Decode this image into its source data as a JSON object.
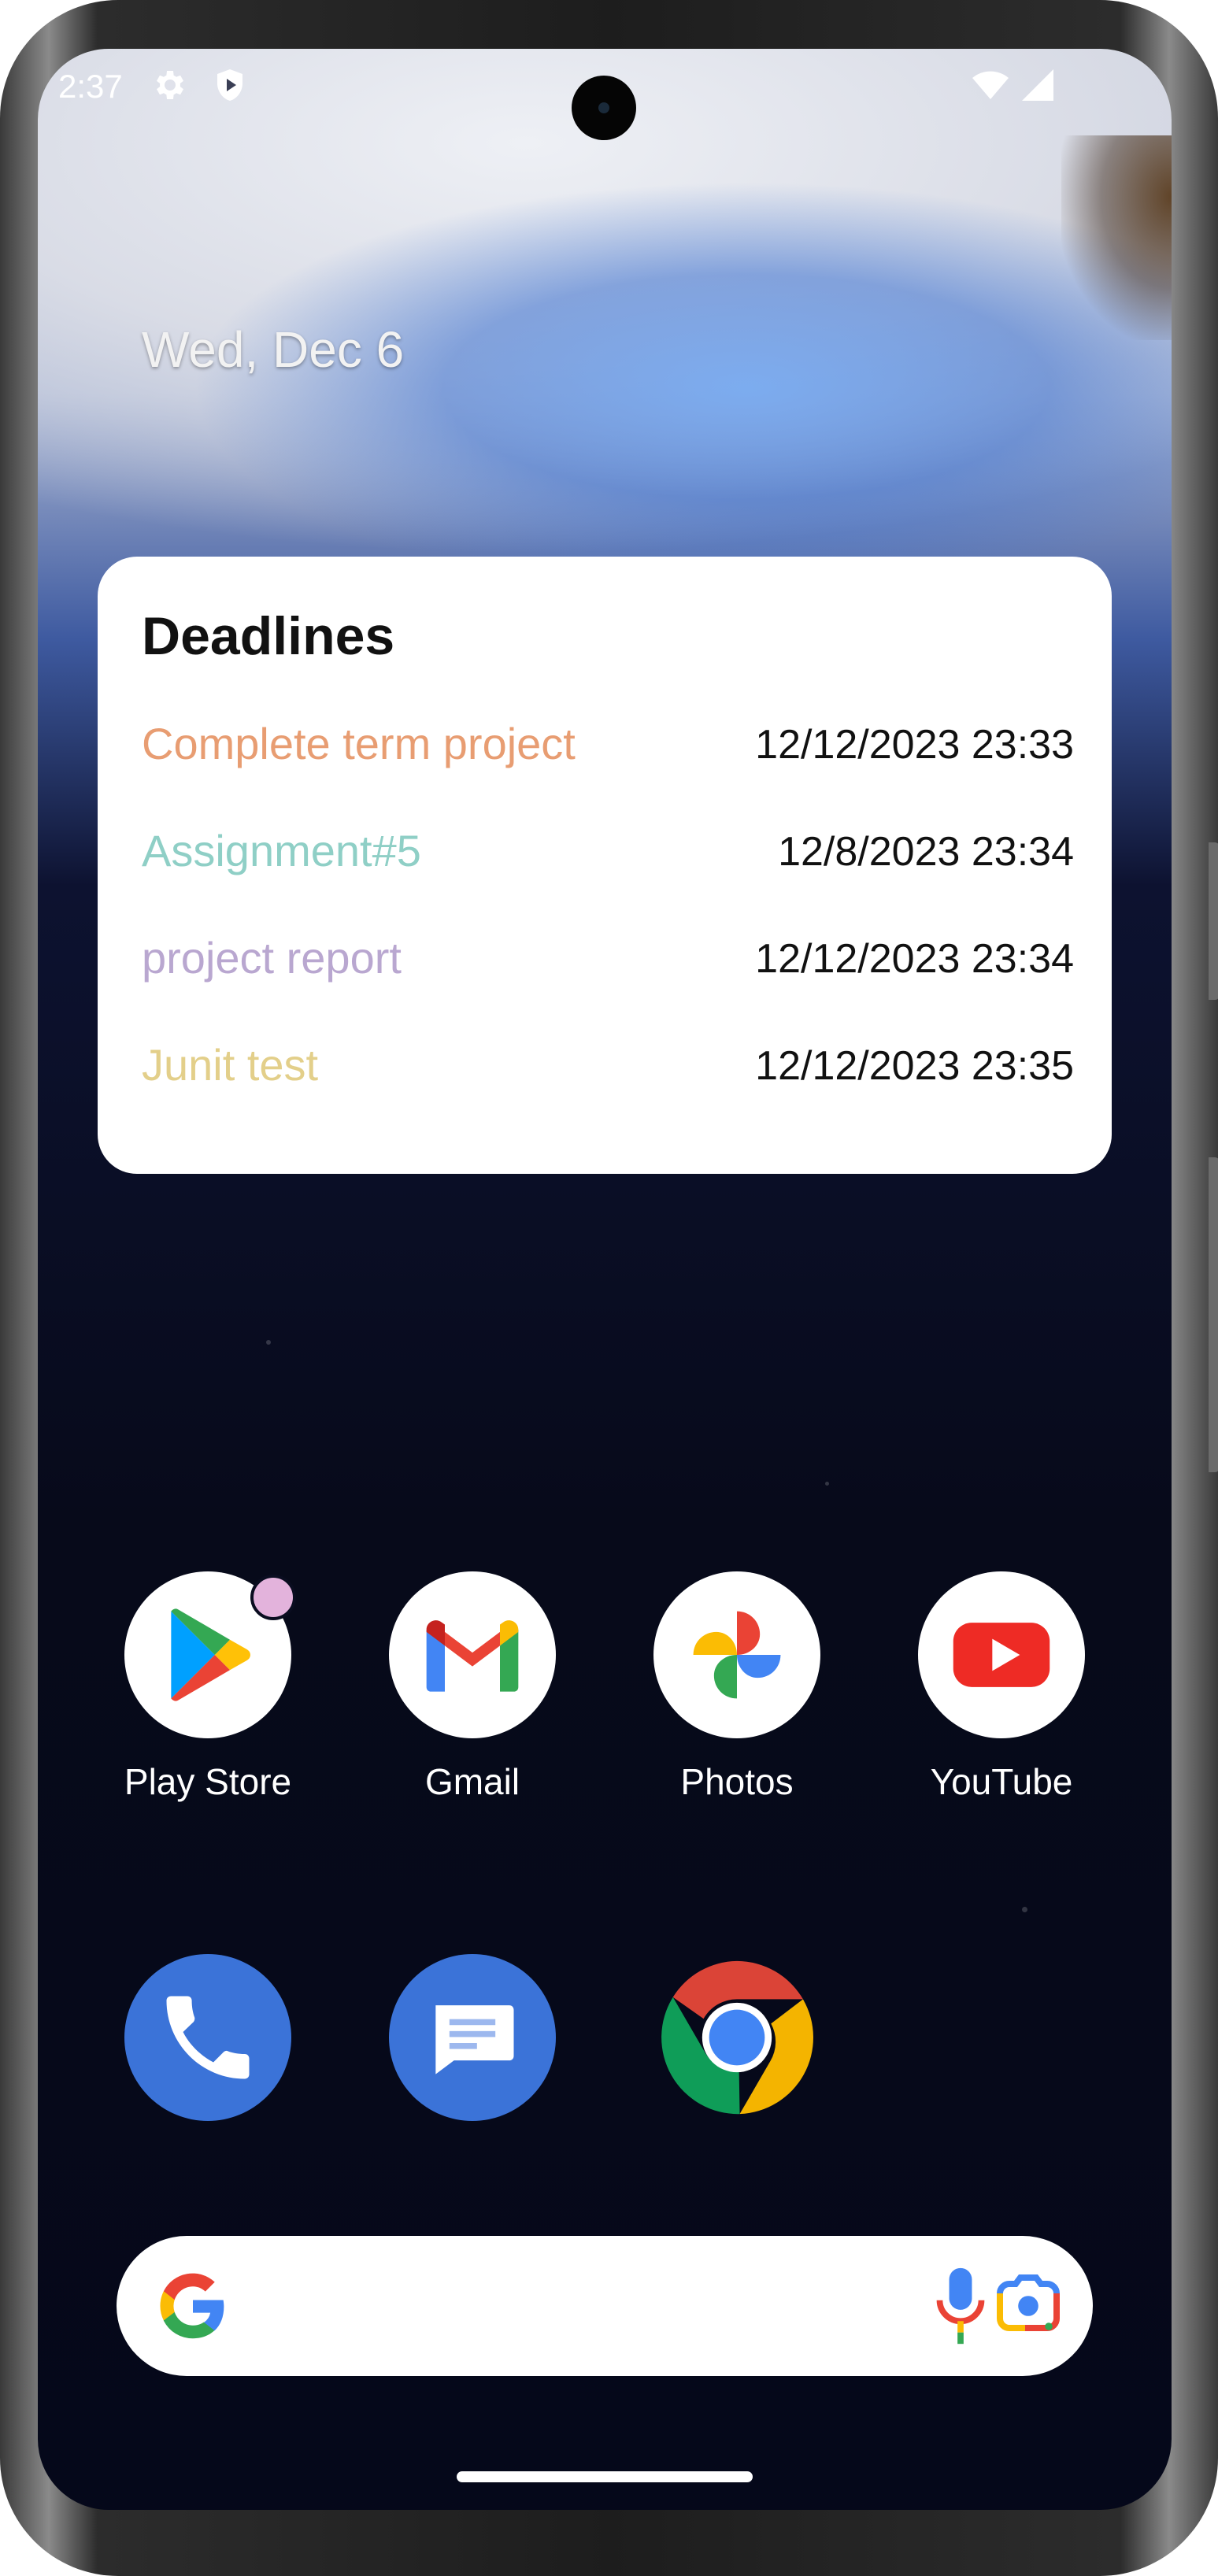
{
  "status_bar": {
    "time": "2:37",
    "icons": [
      "settings-gear-icon",
      "shield-play-icon",
      "wifi-icon",
      "cellular-signal-icon"
    ]
  },
  "home": {
    "date": "Wed, Dec 6"
  },
  "widget": {
    "title": "Deadlines",
    "items": [
      {
        "name": "Complete term project",
        "due": "12/12/2023 23:33",
        "color": "#E89D72"
      },
      {
        "name": "Assignment#5",
        "due": "12/8/2023 23:34",
        "color": "#8FCFC6"
      },
      {
        "name": "project report",
        "due": "12/12/2023 23:34",
        "color": "#B9A7D0"
      },
      {
        "name": "Junit test",
        "due": "12/12/2023 23:35",
        "color": "#E3CF8A"
      }
    ]
  },
  "apps": {
    "row1": [
      {
        "label": "Play Store",
        "icon": "play-store-icon",
        "has_badge": true
      },
      {
        "label": "Gmail",
        "icon": "gmail-icon"
      },
      {
        "label": "Photos",
        "icon": "photos-icon"
      },
      {
        "label": "YouTube",
        "icon": "youtube-icon"
      }
    ],
    "row2": [
      {
        "label": "",
        "icon": "phone-icon"
      },
      {
        "label": "",
        "icon": "messages-icon"
      },
      {
        "label": "",
        "icon": "chrome-icon"
      }
    ]
  },
  "search": {
    "icons": [
      "google-g-icon",
      "microphone-icon",
      "google-lens-icon"
    ]
  },
  "colors": {
    "badge": "#E3B3DC",
    "phone_blue": "#3B73D8",
    "youtube_red": "#FF0000"
  }
}
